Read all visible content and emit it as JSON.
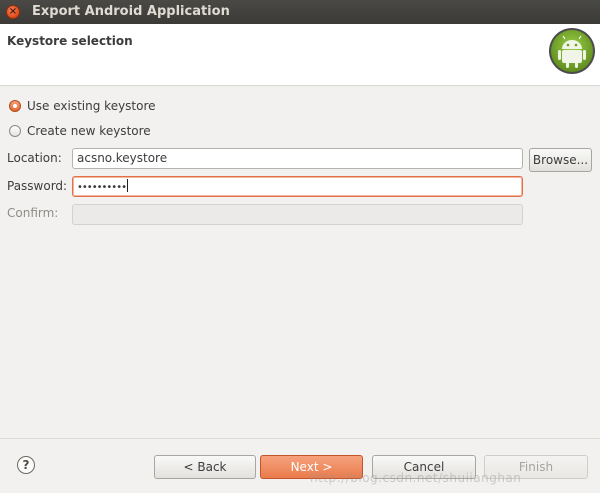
{
  "window": {
    "title": "Export Android Application"
  },
  "header": {
    "title": "Keystore selection",
    "logo_icon": "android-logo-icon"
  },
  "options": {
    "use_existing": {
      "label": "Use existing keystore",
      "selected": true
    },
    "create_new": {
      "label": "Create new keystore",
      "selected": false
    }
  },
  "form": {
    "location_label": "Location:",
    "location_value": "acsno.keystore",
    "browse_label": "Browse...",
    "password_label": "Password:",
    "password_value": "••••••••••",
    "confirm_label": "Confirm:",
    "confirm_value": ""
  },
  "footer": {
    "help_icon": "help-icon",
    "help_glyph": "?",
    "back_label": "< Back",
    "next_label": "Next >",
    "cancel_label": "Cancel",
    "finish_label": "Finish"
  },
  "watermark": "http://blog.csdn.net/shuiianghan",
  "colors": {
    "accent": "#e97847",
    "titlebar": "#3c3b37",
    "focus_border": "#e4704a",
    "android_green": "#a4c639"
  }
}
